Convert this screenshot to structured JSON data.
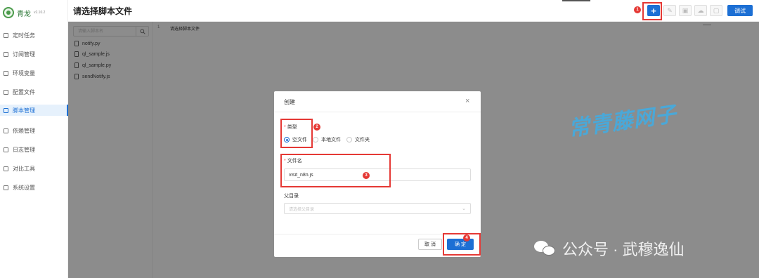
{
  "app": {
    "name": "青龙",
    "version": "v2.10.2"
  },
  "sidebar": {
    "items": [
      {
        "label": "定时任务"
      },
      {
        "label": "订阅管理"
      },
      {
        "label": "环境变量"
      },
      {
        "label": "配置文件"
      },
      {
        "label": "脚本管理",
        "active": true
      },
      {
        "label": "依赖管理"
      },
      {
        "label": "日志管理"
      },
      {
        "label": "对比工具"
      },
      {
        "label": "系统设置"
      }
    ]
  },
  "header": {
    "title": "请选择脚本文件",
    "add_icon": "+",
    "debug_label": "调试"
  },
  "file_panel": {
    "search_placeholder": "请输入脚本名",
    "files": [
      "notify.py",
      "ql_sample.js",
      "ql_sample.py",
      "sendNotify.js"
    ]
  },
  "editor": {
    "line_number": "1",
    "content": "请选择脚本文件"
  },
  "modal": {
    "title": "创建",
    "close_icon": "×",
    "type_label": "类型",
    "type_options": [
      {
        "label": "空文件",
        "checked": true
      },
      {
        "label": "本地文件",
        "checked": false
      },
      {
        "label": "文件夹",
        "checked": false
      }
    ],
    "filename_label": "文件名",
    "filename_value": "visit_n8n.js",
    "parent_label": "父目录",
    "parent_placeholder": "请选择父目录",
    "cancel_label": "取 消",
    "ok_label": "确 定"
  },
  "callouts": [
    "1",
    "2",
    "3",
    "4"
  ],
  "watermarks": {
    "brand": "常青藤网子",
    "wechat": "公众号 · 武穆逸仙"
  },
  "colors": {
    "primary": "#1c6fd4",
    "highlight": "#e53935",
    "brand_watermark": "#4aa8d8"
  }
}
